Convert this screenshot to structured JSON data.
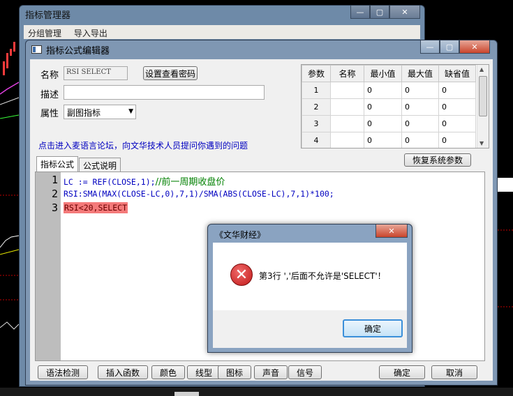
{
  "back_window": {
    "title": "指标管理器",
    "menu": [
      "分组管理",
      "导入导出"
    ],
    "caption": [
      "—",
      "▢",
      "✕"
    ]
  },
  "main_window": {
    "title": "指标公式编辑器",
    "caption": [
      "—",
      "▢",
      "✕"
    ],
    "name_label": "名称",
    "name_value": "RSI SELECT",
    "set_password_button": "设置查看密码",
    "desc_label": "描述",
    "desc_value": "",
    "attr_label": "属性",
    "attr_value": "副图指标",
    "forum_link": "点击进入麦语言论坛，向文华技术人员提问你遇到的问题",
    "restore_button": "恢复系统参数",
    "param_table": {
      "headers": [
        "参数",
        "名称",
        "最小值",
        "最大值",
        "缺省值"
      ],
      "rows": [
        {
          "idx": "1",
          "name": "",
          "min": "0",
          "max": "0",
          "def": "0"
        },
        {
          "idx": "2",
          "name": "",
          "min": "0",
          "max": "0",
          "def": "0"
        },
        {
          "idx": "3",
          "name": "",
          "min": "0",
          "max": "0",
          "def": "0"
        },
        {
          "idx": "4",
          "name": "",
          "min": "0",
          "max": "0",
          "def": "0"
        }
      ]
    },
    "tabs": [
      "指标公式",
      "公式说明"
    ],
    "code_lines": [
      {
        "num": "1",
        "code": "LC := REF(CLOSE,1);",
        "comment": "//前一周期收盘价"
      },
      {
        "num": "2",
        "code": "RSI:SMA(MAX(CLOSE-LC,0),7,1)/SMA(ABS(CLOSE-LC),7,1)*100;",
        "comment": ""
      },
      {
        "num": "3",
        "code": "RSI<20,SELECT",
        "comment": ""
      }
    ],
    "bottom_buttons": [
      "语法检测",
      "插入函数",
      "颜色",
      "线型",
      "图标",
      "声音",
      "信号"
    ],
    "ok_button": "确定",
    "cancel_button": "取消"
  },
  "message_box": {
    "title": "《文华财经》",
    "close": "✕",
    "message": "第3行 ','后面不允许是'SELECT'！",
    "ok_button": "确定",
    "icon": "error-icon"
  },
  "colors": {
    "error_highlight": "#f47a7a",
    "keyword": "#0000c0",
    "comment": "#008000",
    "link": "#0000c0"
  }
}
